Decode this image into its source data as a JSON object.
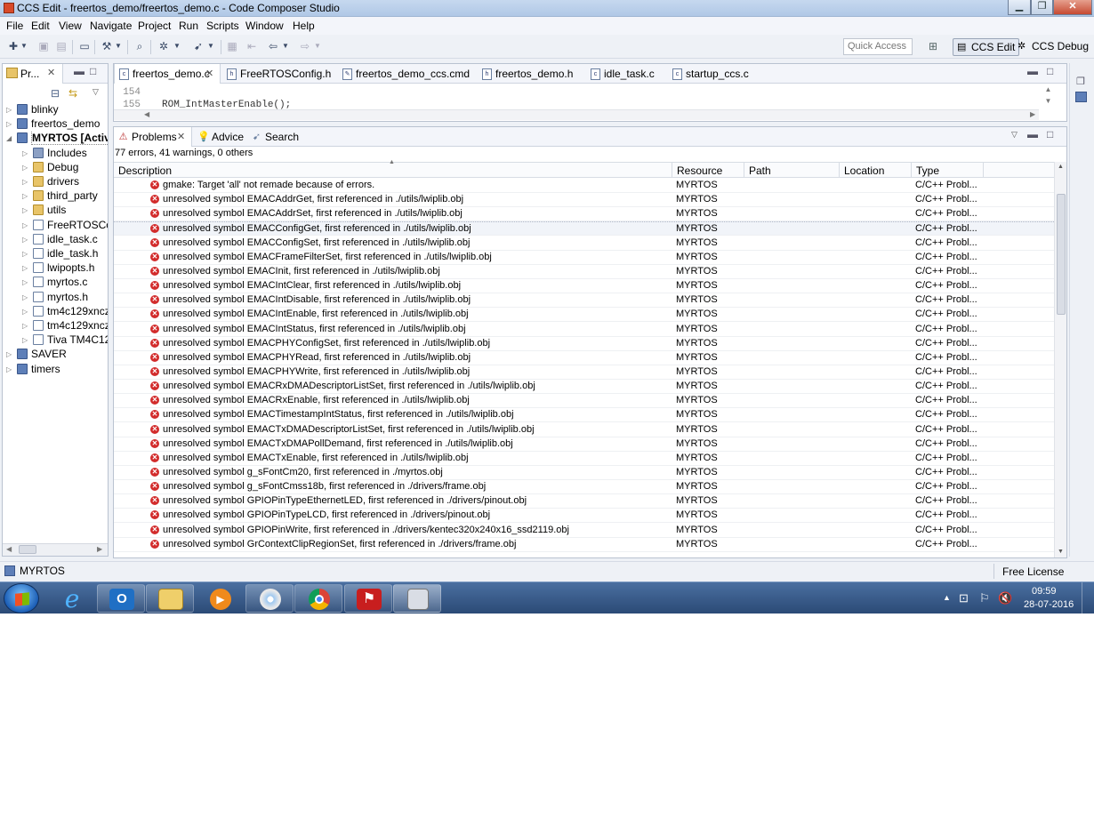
{
  "window": {
    "title": "CCS Edit - freertos_demo/freertos_demo.c - Code Composer Studio",
    "controls": [
      "minimize",
      "maximize",
      "close"
    ]
  },
  "menu": [
    "File",
    "Edit",
    "View",
    "Navigate",
    "Project",
    "Run",
    "Scripts",
    "Window",
    "Help"
  ],
  "toolbar": {
    "quick_access_placeholder": "Quick Access",
    "perspectives": [
      {
        "label": "CCS Edit",
        "active": true
      },
      {
        "label": "CCS Debug",
        "active": false
      }
    ]
  },
  "explorer": {
    "tab_label": "Pr...",
    "items": [
      {
        "label": "blinky",
        "type": "project",
        "level": 0
      },
      {
        "label": "freertos_demo",
        "type": "project",
        "level": 0
      },
      {
        "label": "MYRTOS  [Activ",
        "type": "project",
        "level": 0,
        "expanded": true,
        "bold": true
      },
      {
        "label": "Includes",
        "type": "lib",
        "level": 1
      },
      {
        "label": "Debug",
        "type": "folder",
        "level": 1
      },
      {
        "label": "drivers",
        "type": "folder",
        "level": 1
      },
      {
        "label": "third_party",
        "type": "folder",
        "level": 1
      },
      {
        "label": "utils",
        "type": "folder",
        "level": 1
      },
      {
        "label": "FreeRTOSCo",
        "type": "file",
        "level": 1
      },
      {
        "label": "idle_task.c",
        "type": "file",
        "level": 1
      },
      {
        "label": "idle_task.h",
        "type": "file",
        "level": 1
      },
      {
        "label": "lwipopts.h",
        "type": "file",
        "level": 1
      },
      {
        "label": "myrtos.c",
        "type": "file",
        "level": 1
      },
      {
        "label": "myrtos.h",
        "type": "file",
        "level": 1
      },
      {
        "label": "tm4c129xncz",
        "type": "file",
        "level": 1
      },
      {
        "label": "tm4c129xncz",
        "type": "file",
        "level": 1
      },
      {
        "label": "Tiva TM4C12",
        "type": "file",
        "level": 1
      },
      {
        "label": "SAVER",
        "type": "project",
        "level": 0
      },
      {
        "label": "timers",
        "type": "project",
        "level": 0
      }
    ]
  },
  "editor": {
    "tabs": [
      {
        "label": "freertos_demo.c",
        "active": true,
        "closable": true
      },
      {
        "label": "FreeRTOSConfig.h"
      },
      {
        "label": "freertos_demo_ccs.cmd"
      },
      {
        "label": "freertos_demo.h"
      },
      {
        "label": "idle_task.c"
      },
      {
        "label": "startup_ccs.c"
      }
    ],
    "lines": [
      {
        "num": "154",
        "text": ""
      },
      {
        "num": "155",
        "text": "ROM_IntMasterEnable();"
      }
    ]
  },
  "problems": {
    "tabs": [
      {
        "label": "Problems",
        "active": true
      },
      {
        "label": "Advice"
      },
      {
        "label": "Search"
      }
    ],
    "summary": "77 errors, 41 warnings, 0 others",
    "columns": [
      "Description",
      "Resource",
      "Path",
      "Location",
      "Type"
    ],
    "rows": [
      {
        "description": "gmake: Target 'all' not remade because of errors.",
        "resource": "MYRTOS",
        "path": "",
        "location": "",
        "type": "C/C++ Probl..."
      },
      {
        "description": "unresolved symbol EMACAddrGet, first referenced in ./utils/lwiplib.obj",
        "resource": "MYRTOS",
        "path": "",
        "location": "",
        "type": "C/C++ Probl..."
      },
      {
        "description": "unresolved symbol EMACAddrSet, first referenced in ./utils/lwiplib.obj",
        "resource": "MYRTOS",
        "path": "",
        "location": "",
        "type": "C/C++ Probl..."
      },
      {
        "description": "unresolved symbol EMACConfigGet, first referenced in ./utils/lwiplib.obj",
        "resource": "MYRTOS",
        "path": "",
        "location": "",
        "type": "C/C++ Probl...",
        "selected": true
      },
      {
        "description": "unresolved symbol EMACConfigSet, first referenced in ./utils/lwiplib.obj",
        "resource": "MYRTOS",
        "path": "",
        "location": "",
        "type": "C/C++ Probl..."
      },
      {
        "description": "unresolved symbol EMACFrameFilterSet, first referenced in ./utils/lwiplib.obj",
        "resource": "MYRTOS",
        "path": "",
        "location": "",
        "type": "C/C++ Probl..."
      },
      {
        "description": "unresolved symbol EMACInit, first referenced in ./utils/lwiplib.obj",
        "resource": "MYRTOS",
        "path": "",
        "location": "",
        "type": "C/C++ Probl..."
      },
      {
        "description": "unresolved symbol EMACIntClear, first referenced in ./utils/lwiplib.obj",
        "resource": "MYRTOS",
        "path": "",
        "location": "",
        "type": "C/C++ Probl..."
      },
      {
        "description": "unresolved symbol EMACIntDisable, first referenced in ./utils/lwiplib.obj",
        "resource": "MYRTOS",
        "path": "",
        "location": "",
        "type": "C/C++ Probl..."
      },
      {
        "description": "unresolved symbol EMACIntEnable, first referenced in ./utils/lwiplib.obj",
        "resource": "MYRTOS",
        "path": "",
        "location": "",
        "type": "C/C++ Probl..."
      },
      {
        "description": "unresolved symbol EMACIntStatus, first referenced in ./utils/lwiplib.obj",
        "resource": "MYRTOS",
        "path": "",
        "location": "",
        "type": "C/C++ Probl..."
      },
      {
        "description": "unresolved symbol EMACPHYConfigSet, first referenced in ./utils/lwiplib.obj",
        "resource": "MYRTOS",
        "path": "",
        "location": "",
        "type": "C/C++ Probl..."
      },
      {
        "description": "unresolved symbol EMACPHYRead, first referenced in ./utils/lwiplib.obj",
        "resource": "MYRTOS",
        "path": "",
        "location": "",
        "type": "C/C++ Probl..."
      },
      {
        "description": "unresolved symbol EMACPHYWrite, first referenced in ./utils/lwiplib.obj",
        "resource": "MYRTOS",
        "path": "",
        "location": "",
        "type": "C/C++ Probl..."
      },
      {
        "description": "unresolved symbol EMACRxDMADescriptorListSet, first referenced in ./utils/lwiplib.obj",
        "resource": "MYRTOS",
        "path": "",
        "location": "",
        "type": "C/C++ Probl..."
      },
      {
        "description": "unresolved symbol EMACRxEnable, first referenced in ./utils/lwiplib.obj",
        "resource": "MYRTOS",
        "path": "",
        "location": "",
        "type": "C/C++ Probl..."
      },
      {
        "description": "unresolved symbol EMACTimestampIntStatus, first referenced in ./utils/lwiplib.obj",
        "resource": "MYRTOS",
        "path": "",
        "location": "",
        "type": "C/C++ Probl..."
      },
      {
        "description": "unresolved symbol EMACTxDMADescriptorListSet, first referenced in ./utils/lwiplib.obj",
        "resource": "MYRTOS",
        "path": "",
        "location": "",
        "type": "C/C++ Probl..."
      },
      {
        "description": "unresolved symbol EMACTxDMAPollDemand, first referenced in ./utils/lwiplib.obj",
        "resource": "MYRTOS",
        "path": "",
        "location": "",
        "type": "C/C++ Probl..."
      },
      {
        "description": "unresolved symbol EMACTxEnable, first referenced in ./utils/lwiplib.obj",
        "resource": "MYRTOS",
        "path": "",
        "location": "",
        "type": "C/C++ Probl..."
      },
      {
        "description": "unresolved symbol g_sFontCm20, first referenced in ./myrtos.obj",
        "resource": "MYRTOS",
        "path": "",
        "location": "",
        "type": "C/C++ Probl..."
      },
      {
        "description": "unresolved symbol g_sFontCmss18b, first referenced in ./drivers/frame.obj",
        "resource": "MYRTOS",
        "path": "",
        "location": "",
        "type": "C/C++ Probl..."
      },
      {
        "description": "unresolved symbol GPIOPinTypeEthernetLED, first referenced in ./drivers/pinout.obj",
        "resource": "MYRTOS",
        "path": "",
        "location": "",
        "type": "C/C++ Probl..."
      },
      {
        "description": "unresolved symbol GPIOPinTypeLCD, first referenced in ./drivers/pinout.obj",
        "resource": "MYRTOS",
        "path": "",
        "location": "",
        "type": "C/C++ Probl..."
      },
      {
        "description": "unresolved symbol GPIOPinWrite, first referenced in ./drivers/kentec320x240x16_ssd2119.obj",
        "resource": "MYRTOS",
        "path": "",
        "location": "",
        "type": "C/C++ Probl..."
      },
      {
        "description": "unresolved symbol GrContextClipRegionSet, first referenced in ./drivers/frame.obj",
        "resource": "MYRTOS",
        "path": "",
        "location": "",
        "type": "C/C++ Probl..."
      }
    ]
  },
  "statusbar": {
    "selected_project": "MYRTOS",
    "license": "Free License"
  },
  "taskbar": {
    "apps": [
      "internet-explorer",
      "outlook",
      "file-explorer",
      "media-player",
      "paint",
      "chrome",
      "acrobat",
      "code-composer-studio"
    ],
    "time": "09:59",
    "date": "28-07-2016"
  },
  "colors": {
    "error": "#d22b2b",
    "taskbar": "#2b4a76",
    "titlebar": "#b0c8e6"
  }
}
